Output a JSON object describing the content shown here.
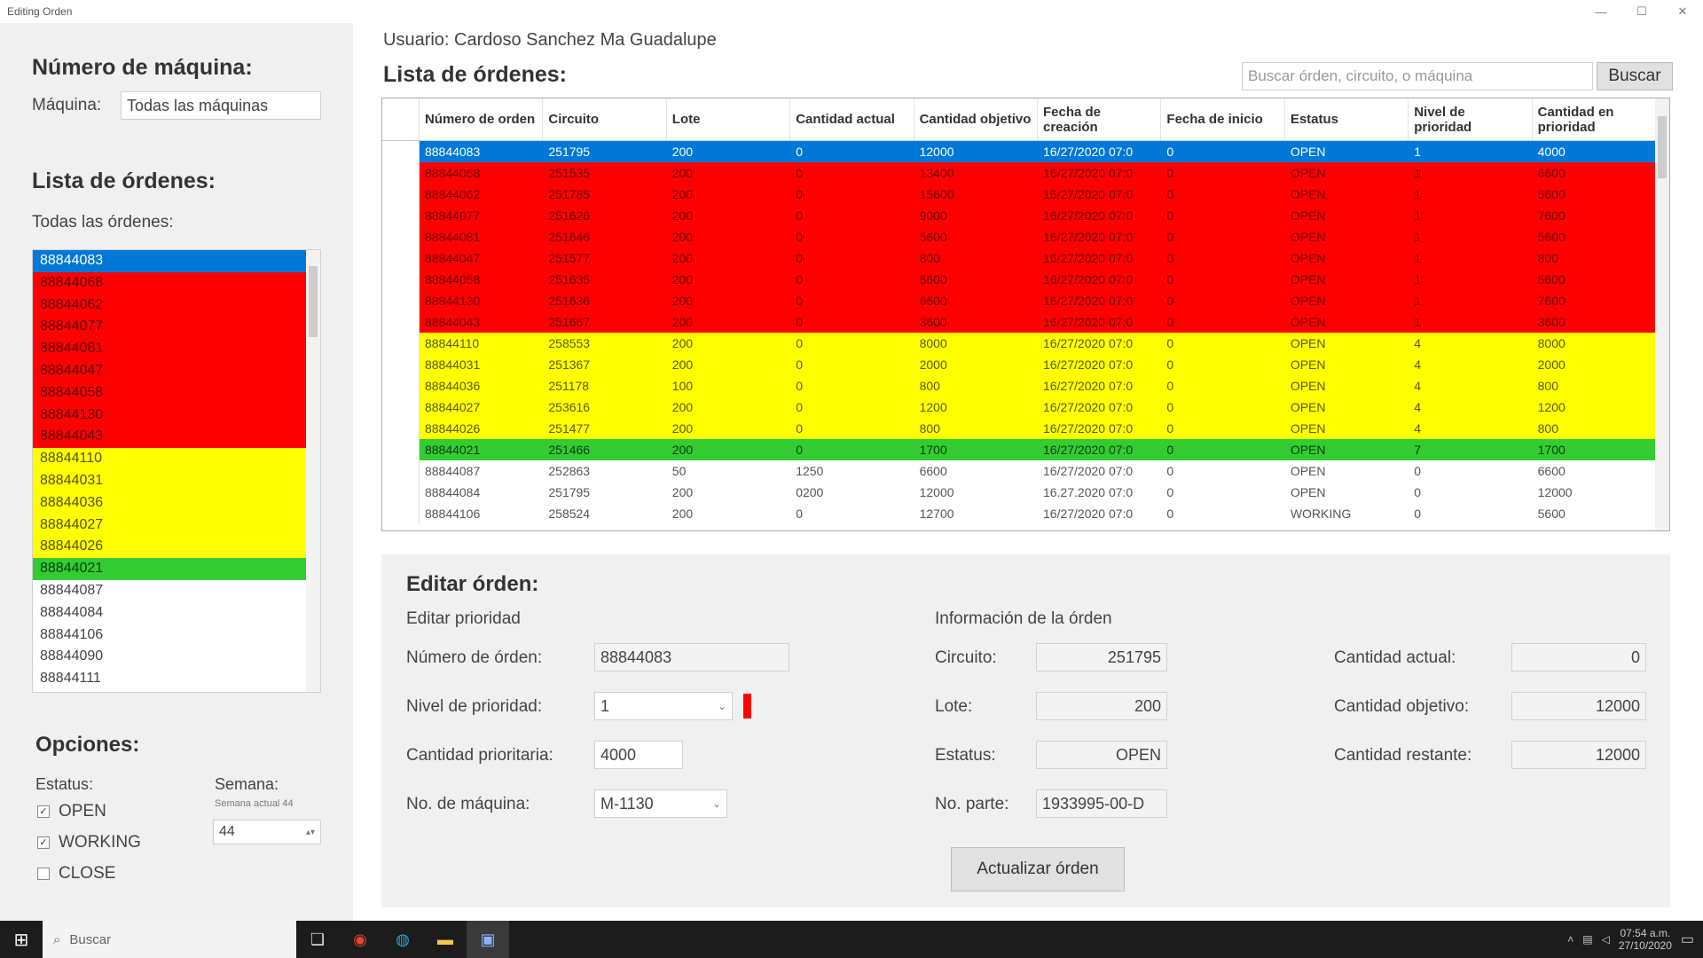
{
  "window": {
    "title": "Editing Orden",
    "minimize": "—",
    "maximize": "☐",
    "close": "✕"
  },
  "left": {
    "machine_title": "Número de máquina:",
    "machine_label": "Máquina:",
    "machine_value": "Todas las máquinas",
    "orders_title": "Lista de órdenes:",
    "orders_subtitle": "Todas las órdenes:",
    "orders": [
      {
        "id": "88844083",
        "color": "#0078d7",
        "text_color": "#ffffff"
      },
      {
        "id": "88844068",
        "color": "#ff0000",
        "text_color": "#5a0000"
      },
      {
        "id": "88844062",
        "color": "#ff0000",
        "text_color": "#5a0000"
      },
      {
        "id": "88844077",
        "color": "#ff0000",
        "text_color": "#5a0000"
      },
      {
        "id": "88844081",
        "color": "#ff0000",
        "text_color": "#5a0000"
      },
      {
        "id": "88844047",
        "color": "#ff0000",
        "text_color": "#5a0000"
      },
      {
        "id": "88844058",
        "color": "#ff0000",
        "text_color": "#5a0000"
      },
      {
        "id": "88844130",
        "color": "#ff0000",
        "text_color": "#5a0000"
      },
      {
        "id": "88844043",
        "color": "#ff0000",
        "text_color": "#5a0000"
      },
      {
        "id": "88844110",
        "color": "#ffff00",
        "text_color": "#555500"
      },
      {
        "id": "88844031",
        "color": "#ffff00",
        "text_color": "#555500"
      },
      {
        "id": "88844036",
        "color": "#ffff00",
        "text_color": "#555500"
      },
      {
        "id": "88844027",
        "color": "#ffff00",
        "text_color": "#555500"
      },
      {
        "id": "88844026",
        "color": "#ffff00",
        "text_color": "#555500"
      },
      {
        "id": "88844021",
        "color": "#33cc33",
        "text_color": "#0b3d0b"
      },
      {
        "id": "88844087",
        "color": "#ffffff",
        "text_color": "#444444"
      },
      {
        "id": "88844084",
        "color": "#ffffff",
        "text_color": "#444444"
      },
      {
        "id": "88844106",
        "color": "#ffffff",
        "text_color": "#444444"
      },
      {
        "id": "88844090",
        "color": "#ffffff",
        "text_color": "#444444"
      },
      {
        "id": "88844111",
        "color": "#ffffff",
        "text_color": "#444444"
      }
    ],
    "options_title": "Opciones:",
    "status_label": "Estatus:",
    "status_options": [
      {
        "label": "OPEN",
        "checked": true
      },
      {
        "label": "WORKING",
        "checked": true
      },
      {
        "label": "CLOSE",
        "checked": false
      }
    ],
    "week_label": "Semana:",
    "week_hint": "Semana actual 44",
    "week_value": "44"
  },
  "main": {
    "user_label": "Usuario: Cardoso Sanchez Ma Guadalupe",
    "list_title": "Lista de órdenes:",
    "search_placeholder": "Buscar órden, circuito, o máquina",
    "search_button": "Buscar",
    "columns": [
      "Número de orden",
      "Circuito",
      "Lote",
      "Cantidad actual",
      "Cantidad objetivo",
      "Fecha de creación",
      "Fecha de inicio",
      "Estatus",
      "Nivel de prioridad",
      "Cantidad en prioridad"
    ],
    "rows": [
      {
        "color": "#0078d7",
        "text": "#ffffff",
        "cells": [
          "88844083",
          "251795",
          "200",
          "0",
          "12000",
          "16/27/2020 07:0",
          "0",
          "OPEN",
          "1",
          "4000"
        ]
      },
      {
        "color": "#ff0000",
        "text": "#6a0000",
        "cells": [
          "88844068",
          "251535",
          "200",
          "0",
          "13400",
          "16/27/2020 07:0",
          "0",
          "OPEN",
          "1",
          "6600"
        ]
      },
      {
        "color": "#ff0000",
        "text": "#6a0000",
        "cells": [
          "88844062",
          "251785",
          "200",
          "0",
          "15600",
          "16/27/2020 07:0",
          "0",
          "OPEN",
          "1",
          "5600"
        ]
      },
      {
        "color": "#ff0000",
        "text": "#6a0000",
        "cells": [
          "88844077",
          "251626",
          "200",
          "0",
          "9000",
          "16/27/2020 07:0",
          "0",
          "OPEN",
          "1",
          "7600"
        ]
      },
      {
        "color": "#ff0000",
        "text": "#6a0000",
        "cells": [
          "88844081",
          "251646",
          "200",
          "0",
          "5600",
          "16/27/2020 07:0",
          "0",
          "OPEN",
          "1",
          "5600"
        ]
      },
      {
        "color": "#ff0000",
        "text": "#6a0000",
        "cells": [
          "88844047",
          "251577",
          "200",
          "0",
          "800",
          "16/27/2020 07:0",
          "0",
          "OPEN",
          "1",
          "800"
        ]
      },
      {
        "color": "#ff0000",
        "text": "#6a0000",
        "cells": [
          "88844058",
          "251635",
          "200",
          "0",
          "5600",
          "16/27/2020 07:0",
          "0",
          "OPEN",
          "1",
          "5600"
        ]
      },
      {
        "color": "#ff0000",
        "text": "#6a0000",
        "cells": [
          "88844130",
          "251636",
          "200",
          "0",
          "6600",
          "16/27/2020 07:0",
          "0",
          "OPEN",
          "1",
          "7600"
        ]
      },
      {
        "color": "#ff0000",
        "text": "#6a0000",
        "cells": [
          "88844043",
          "251667",
          "200",
          "0",
          "3600",
          "16/27/2020 07:0",
          "0",
          "OPEN",
          "1",
          "3600"
        ]
      },
      {
        "color": "#ffff00",
        "text": "#5a5a00",
        "cells": [
          "88844110",
          "258553",
          "200",
          "0",
          "8000",
          "16/27/2020 07:0",
          "0",
          "OPEN",
          "4",
          "8000"
        ]
      },
      {
        "color": "#ffff00",
        "text": "#5a5a00",
        "cells": [
          "88844031",
          "251367",
          "200",
          "0",
          "2000",
          "16/27/2020 07:0",
          "0",
          "OPEN",
          "4",
          "2000"
        ]
      },
      {
        "color": "#ffff00",
        "text": "#5a5a00",
        "cells": [
          "88844036",
          "251178",
          "100",
          "0",
          "800",
          "16/27/2020 07:0",
          "0",
          "OPEN",
          "4",
          "800"
        ]
      },
      {
        "color": "#ffff00",
        "text": "#5a5a00",
        "cells": [
          "88844027",
          "253616",
          "200",
          "0",
          "1200",
          "16/27/2020 07:0",
          "0",
          "OPEN",
          "4",
          "1200"
        ]
      },
      {
        "color": "#ffff00",
        "text": "#5a5a00",
        "cells": [
          "88844026",
          "251477",
          "200",
          "0",
          "800",
          "16/27/2020 07:0",
          "0",
          "OPEN",
          "4",
          "800"
        ]
      },
      {
        "color": "#33cc33",
        "text": "#0b3d0b",
        "cells": [
          "88844021",
          "251466",
          "200",
          "0",
          "1700",
          "16/27/2020 07:0",
          "0",
          "OPEN",
          "7",
          "1700"
        ]
      },
      {
        "color": "#ffffff",
        "text": "#555555",
        "cells": [
          "88844087",
          "252863",
          "50",
          "1250",
          "6600",
          "16/27/2020 07:0",
          "0",
          "OPEN",
          "0",
          "6600"
        ]
      },
      {
        "color": "#ffffff",
        "text": "#555555",
        "cells": [
          "88844084",
          "251795",
          "200",
          "0200",
          "12000",
          "16.27.2020 07:0",
          "0",
          "OPEN",
          "0",
          "12000"
        ]
      },
      {
        "color": "#ffffff",
        "text": "#555555",
        "cells": [
          "88844106",
          "258524",
          "200",
          "0",
          "12700",
          "16/27/2020 07:0",
          "0",
          "WORKING",
          "0",
          "5600"
        ]
      }
    ],
    "edit": {
      "title": "Editar órden:",
      "priority_section": "Editar prioridad",
      "info_section": "Información de la órden",
      "order_number_label": "Número de órden:",
      "order_number_value": "88844083",
      "priority_level_label": "Nivel de prioridad:",
      "priority_level_value": "1",
      "priority_qty_label": "Cantidad prioritaria:",
      "priority_qty_value": "4000",
      "machine_no_label": "No. de máquina:",
      "machine_no_value": "M-1130",
      "circuit_label": "Circuito:",
      "circuit_value": "251795",
      "lot_label": "Lote:",
      "lot_value": "200",
      "status_label": "Estatus:",
      "status_value": "OPEN",
      "part_label": "No. parte:",
      "part_value": "1933995-00-D",
      "current_qty_label": "Cantidad actual:",
      "current_qty_value": "0",
      "target_qty_label": "Cantidad objetivo:",
      "target_qty_value": "12000",
      "remaining_qty_label": "Cantidad restante:",
      "remaining_qty_value": "12000",
      "update_button": "Actualizar órden",
      "priority_indicator_color": "#ff0000"
    }
  },
  "taskbar": {
    "search_placeholder": "Buscar",
    "time": "07:54 a.m.",
    "date": "27/10/2020"
  }
}
